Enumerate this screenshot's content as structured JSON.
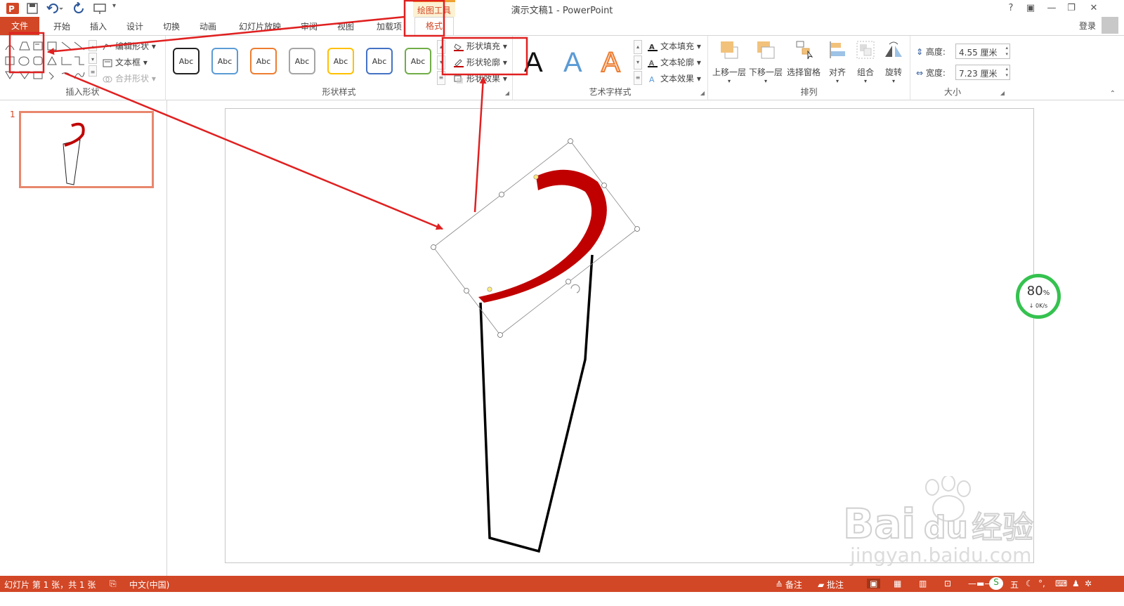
{
  "window": {
    "title": "演示文稿1 - PowerPoint",
    "help": "?",
    "minimize": "—",
    "restore": "❐",
    "close": "✕"
  },
  "tabs": {
    "file": "文件",
    "items": [
      "开始",
      "插入",
      "设计",
      "切换",
      "动画",
      "幻灯片放映",
      "审阅",
      "视图",
      "加载项"
    ],
    "contextual_group": "绘图工具",
    "format": "格式",
    "login": "登录"
  },
  "ribbon": {
    "insert_shapes": {
      "label": "插入形状",
      "edit_shape": "编辑形状",
      "text_box": "文本框",
      "merge_shapes": "合并形状"
    },
    "shape_styles": {
      "label": "形状样式",
      "swatches": [
        {
          "text": "Abc",
          "color": "#222222"
        },
        {
          "text": "Abc",
          "color": "#5b9bd5"
        },
        {
          "text": "Abc",
          "color": "#ed7d31"
        },
        {
          "text": "Abc",
          "color": "#a5a5a5"
        },
        {
          "text": "Abc",
          "color": "#ffc000"
        },
        {
          "text": "Abc",
          "color": "#4472c4"
        },
        {
          "text": "Abc",
          "color": "#70ad47"
        }
      ],
      "fill": "形状填充",
      "outline": "形状轮廓",
      "effects": "形状效果"
    },
    "wordart": {
      "label": "艺术字样式",
      "letters": [
        "A",
        "A",
        "A"
      ],
      "text_fill": "文本填充",
      "text_outline": "文本轮廓",
      "text_effects": "文本效果"
    },
    "arrange": {
      "label": "排列",
      "bring_forward": "上移一层",
      "send_backward": "下移一层",
      "selection_pane": "选择窗格",
      "align": "对齐",
      "group": "组合",
      "rotate": "旋转"
    },
    "size": {
      "label": "大小",
      "height_label": "高度:",
      "height_value": "4.55 厘米",
      "width_label": "宽度:",
      "width_value": "7.23 厘米"
    }
  },
  "thumbnails": {
    "slide_number": "1"
  },
  "net_widget": {
    "percent": "80",
    "percent_unit": "%",
    "speed": "↓ 0K/s"
  },
  "watermark": {
    "brand": "Bai",
    "brand2": "du",
    "cn": "经验",
    "url": "jingyan.baidu.com"
  },
  "statusbar": {
    "slide_info": "幻灯片 第 1 张，共 1 张",
    "language": "中文(中国)",
    "notes": "备注",
    "comments": "批注",
    "ime": "五"
  },
  "colors": {
    "accent": "#d24726",
    "shape_red": "#c00000",
    "annotation": "#e02020",
    "net_green": "#35c24f"
  }
}
